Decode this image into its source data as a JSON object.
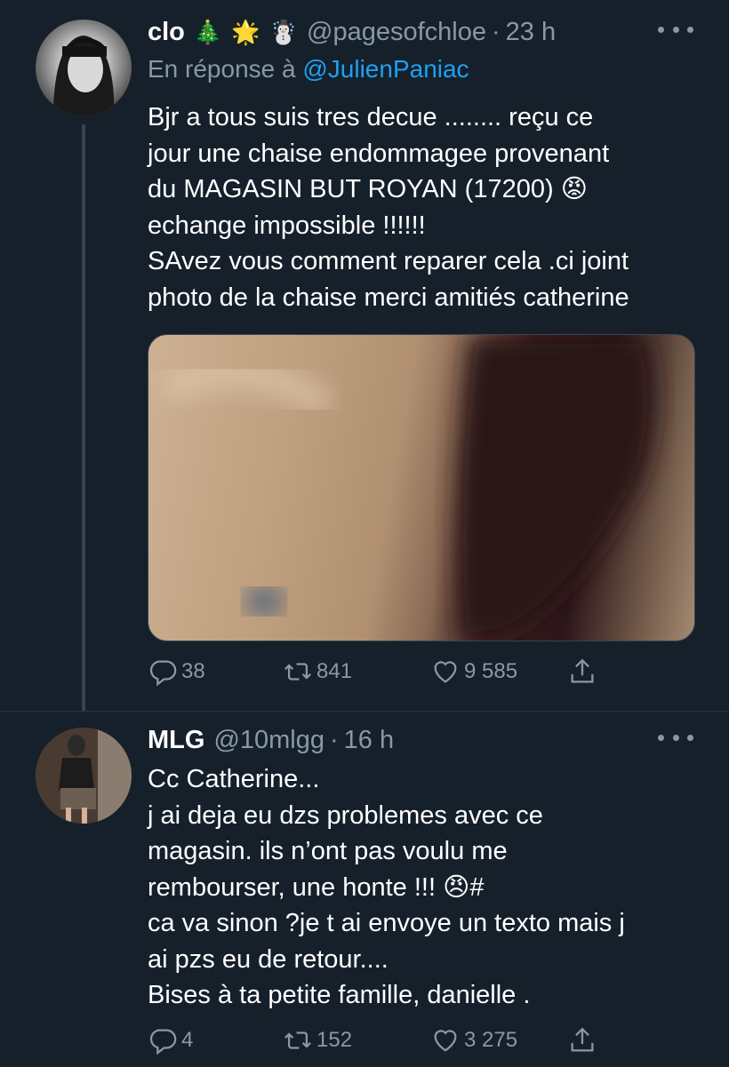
{
  "tweets": [
    {
      "name": "clo",
      "emojis": [
        "🎄",
        "🌟",
        "☃️"
      ],
      "handle": "@pagesofchloe",
      "separator": "·",
      "time": "23 h",
      "reply_prefix": "En réponse à",
      "reply_to": "@JulienPaniac",
      "text": "Bjr a tous suis tres decue ........ reçu ce\njour une chaise endommagee provenant\ndu MAGASIN BUT ROYAN (17200) 😡\nechange impossible !!!!!!\nSAvez vous comment reparer cela .ci joint\nphoto de la chaise merci amitiés catherine",
      "replies": "38",
      "retweets": "841",
      "likes": "9 585"
    },
    {
      "name": "MLG",
      "handle": "@10mlgg",
      "separator": "·",
      "time": "16 h",
      "text": "Cc Catherine...\nj ai deja eu dzs problemes avec ce\nmagasin. ils n’ont pas voulu me\nrembourser, une honte !!! 😠#\nca va sinon ?je t ai envoye un texto mais j\nai pzs eu de retour....\nBises à ta petite famille, danielle .",
      "replies": "4",
      "retweets": "152",
      "likes": "3 275"
    }
  ],
  "icons": {
    "reply": "reply-icon",
    "retweet": "retweet-icon",
    "like": "heart-icon",
    "share": "share-icon",
    "more": "more-icon"
  },
  "colors": {
    "background": "#15202b",
    "secondary_text": "#8899a6",
    "link": "#1da1f2",
    "divider": "#38444d"
  }
}
